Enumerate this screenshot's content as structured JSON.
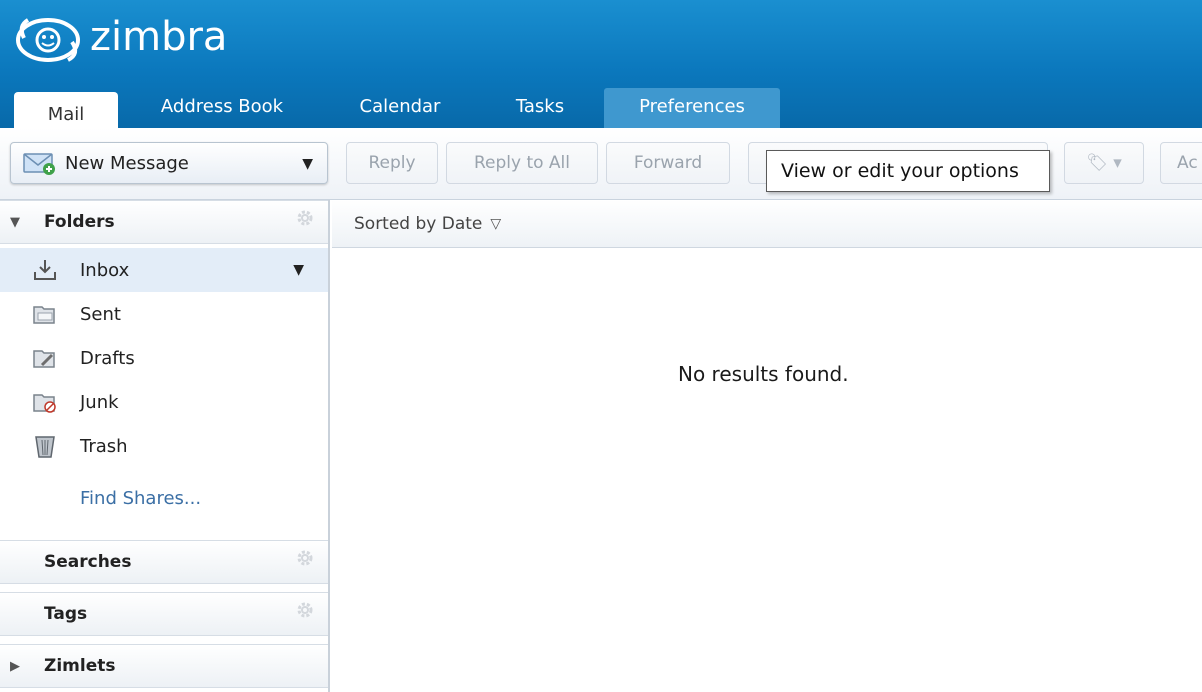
{
  "app": {
    "logo_text": "zimbra"
  },
  "tabs": [
    {
      "label": "Mail",
      "active": true
    },
    {
      "label": "Address Book",
      "active": false
    },
    {
      "label": "Calendar",
      "active": false
    },
    {
      "label": "Tasks",
      "active": false
    },
    {
      "label": "Preferences",
      "active": false,
      "hovered": true
    }
  ],
  "toolbar": {
    "new_message": "New Message",
    "reply": "Reply",
    "reply_all": "Reply to All",
    "forward": "Forward",
    "cut_label": "Ac"
  },
  "tooltip": "View or edit your options",
  "sidebar": {
    "folders_header": "Folders",
    "folders": [
      {
        "label": "Inbox",
        "icon": "inbox-icon",
        "selected": true
      },
      {
        "label": "Sent",
        "icon": "sent-icon"
      },
      {
        "label": "Drafts",
        "icon": "drafts-icon"
      },
      {
        "label": "Junk",
        "icon": "junk-icon"
      },
      {
        "label": "Trash",
        "icon": "trash-icon"
      }
    ],
    "find_shares": "Find Shares...",
    "searches_header": "Searches",
    "tags_header": "Tags",
    "zimlets_header": "Zimlets"
  },
  "list": {
    "sort_label": "Sorted by Date",
    "empty_message": "No results found."
  },
  "colors": {
    "header_blue": "#0b78bd",
    "selected_row": "#e3edf8",
    "link": "#3b6fa5"
  }
}
